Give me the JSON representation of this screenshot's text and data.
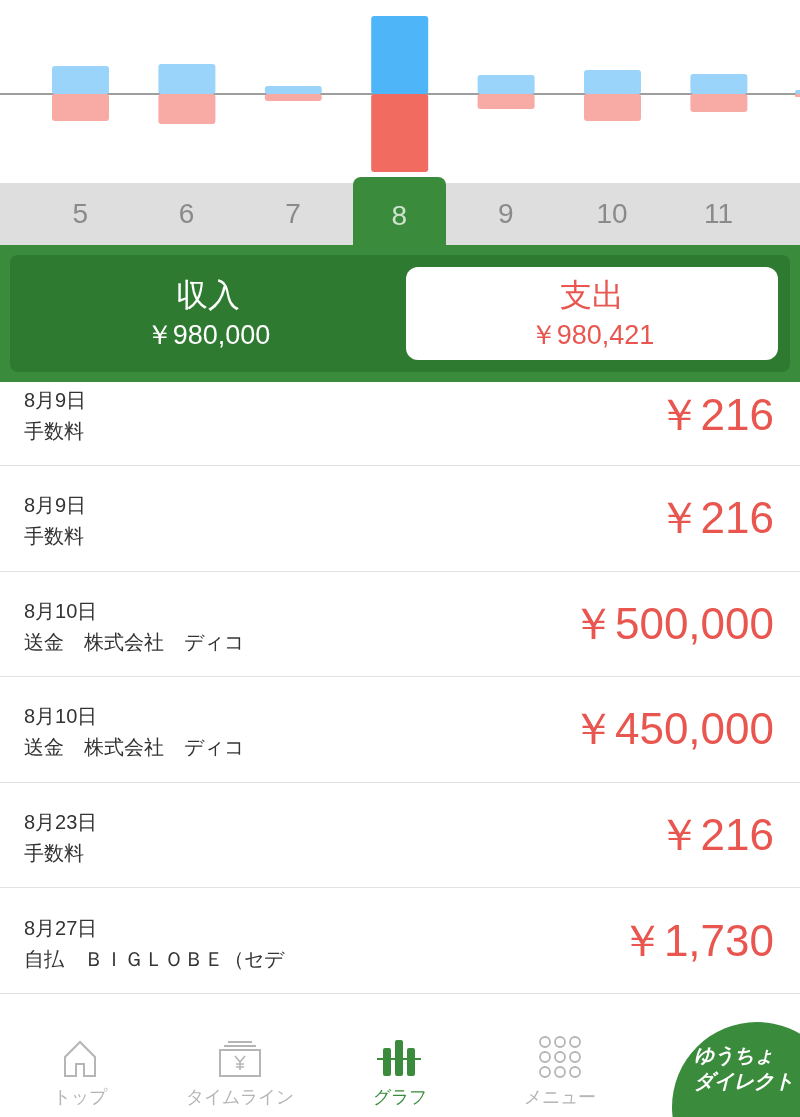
{
  "months": [
    {
      "label": "5",
      "selected": false
    },
    {
      "label": "6",
      "selected": false
    },
    {
      "label": "7",
      "selected": false
    },
    {
      "label": "8",
      "selected": true
    },
    {
      "label": "9",
      "selected": false
    },
    {
      "label": "10",
      "selected": false
    },
    {
      "label": "11",
      "selected": false
    }
  ],
  "summary": [
    {
      "kind": "income",
      "label": "収入",
      "amount": "￥980,000",
      "selected": false
    },
    {
      "kind": "expense",
      "label": "支出",
      "amount": "￥980,421",
      "selected": true
    }
  ],
  "transactions": [
    {
      "date": "8月9日",
      "description": "手数料",
      "amount": "￥216"
    },
    {
      "date": "8月9日",
      "description": "手数料",
      "amount": "￥216"
    },
    {
      "date": "8月10日",
      "description": "送金　株式会社　ディコ",
      "amount": "￥500,000"
    },
    {
      "date": "8月10日",
      "description": "送金　株式会社　ディコ",
      "amount": "￥450,000"
    },
    {
      "date": "8月23日",
      "description": "手数料",
      "amount": "￥216"
    },
    {
      "date": "8月27日",
      "description": "自払　ＢＩＧＬＯＢＥ（セデ",
      "amount": "￥1,730"
    }
  ],
  "tab_bar": [
    {
      "kind": "home",
      "label": "トップ",
      "selected": false
    },
    {
      "kind": "timeline",
      "label": "タイムライン",
      "selected": false
    },
    {
      "kind": "graph",
      "label": "グラフ",
      "selected": true
    },
    {
      "kind": "menu",
      "label": "メニュー",
      "selected": false
    }
  ],
  "direct_button": {
    "lines": [
      "ゆうちょ",
      "ダイレクト"
    ]
  }
}
